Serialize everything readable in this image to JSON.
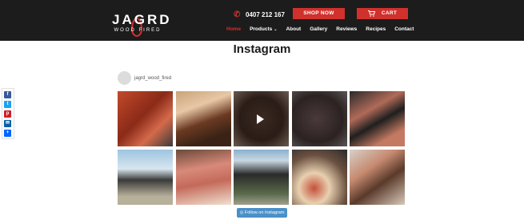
{
  "brand": {
    "name": "JAGRD",
    "tagline": "WOOD FIRED"
  },
  "header": {
    "phone": "0407 212 167",
    "shop_now": "SHOP NOW",
    "cart": "CART"
  },
  "nav": {
    "items": [
      {
        "label": "Home",
        "active": true
      },
      {
        "label": "Products",
        "has_dropdown": true
      },
      {
        "label": "About"
      },
      {
        "label": "Gallery"
      },
      {
        "label": "Reviews"
      },
      {
        "label": "Recipes"
      },
      {
        "label": "Contact"
      }
    ]
  },
  "page": {
    "title": "Instagram"
  },
  "instagram": {
    "username": "jagrd_wood_fired",
    "follow_label": "Follow on Instagram"
  },
  "share": {
    "icons": [
      "facebook-icon",
      "twitter-icon",
      "pinterest-icon",
      "email-icon",
      "more-icon"
    ]
  },
  "colors": {
    "header_bg": "#1c1c1c",
    "accent": "#d0312d",
    "follow_button": "#4a90c9"
  }
}
